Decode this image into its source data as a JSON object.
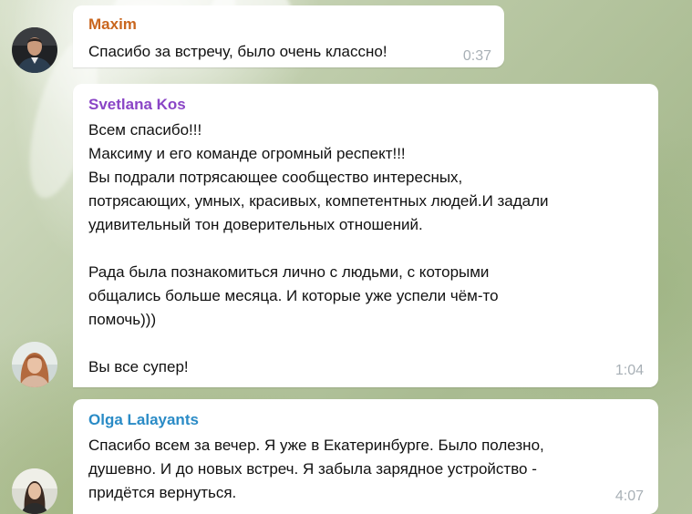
{
  "colors": {
    "maxim_name": "#c9661e",
    "svetlana_name": "#8a45c6",
    "olga_name": "#2a8bc6",
    "bubble_bg": "#ffffff",
    "time": "#a8b0b6"
  },
  "messages": [
    {
      "sender": "Maxim",
      "lines": [
        "Спасибо за встречу, было очень классно!"
      ],
      "time": "0:37"
    },
    {
      "sender": "Svetlana Kos",
      "lines": [
        "Всем спасибо!!!",
        "Максиму и его команде огромный респект!!!",
        "Вы подрали потрясающее сообщество интересных,",
        "потрясающих, умных, красивых, компетентных людей.И задали",
        "удивительный тон доверительных отношений.",
        "",
        "Рада была познакомиться лично с людьми, с которыми",
        "общались больше месяца. И которые уже успели чём-то",
        "помочь)))",
        "",
        "Вы все супер!"
      ],
      "time": "1:04"
    },
    {
      "sender": "Olga Lalayants",
      "lines": [
        "Спасибо всем за вечер. Я уже в Екатеринбурге. Было полезно,",
        "душевно. И до новых встреч. Я забыла зарядное устройство -",
        "придётся вернуться."
      ],
      "time": "4:07"
    }
  ]
}
